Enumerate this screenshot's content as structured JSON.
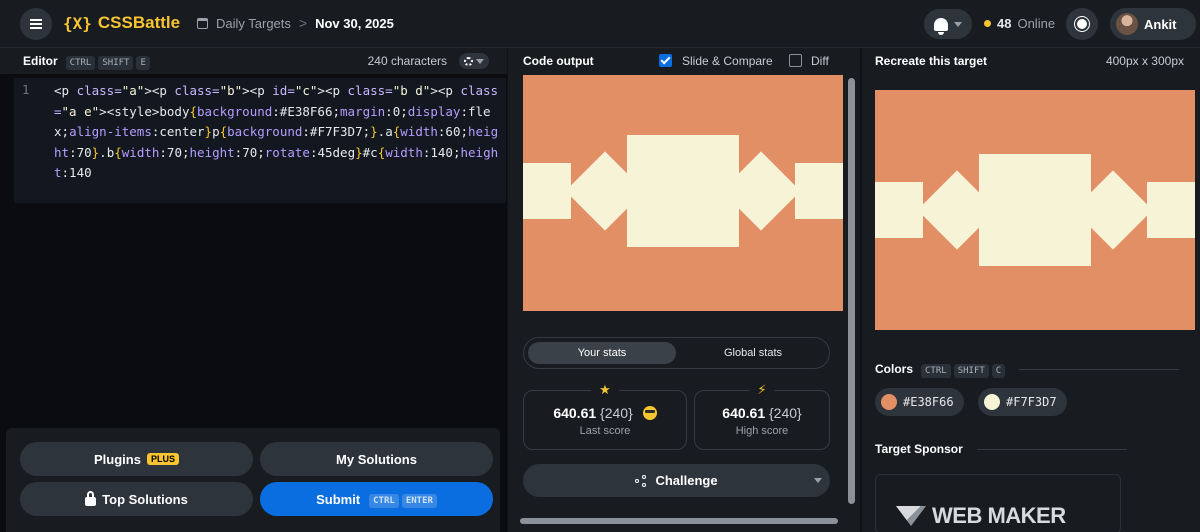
{
  "header": {
    "logo_mark": "{X}",
    "logo_text": "CSSBattle",
    "breadcrumb_section": "Daily Targets",
    "breadcrumb_separator": ">",
    "breadcrumb_date": "Nov 30, 2025",
    "online_count": "48",
    "online_label": "Online",
    "user_name": "Ankit"
  },
  "editor": {
    "title": "Editor",
    "shortcut": [
      "CTRL",
      "SHIFT",
      "E"
    ],
    "char_count": "240 characters",
    "line_number": "1",
    "code": "<p class=\"a\"><p class=\"b\"><p id=\"c\"><p class=\"b d\"><p class=\"a e\"><style>body{background:#E38F66;margin:0;display:flex;align-items:center}p{background:#F7F3D7;}.a{width:60;height:70}.b{width:70;height:70;rotate:45deg}#c{width:140;height:140"
  },
  "actions": {
    "plugins_label": "Plugins",
    "plugins_badge": "PLUS",
    "my_solutions_label": "My Solutions",
    "top_solutions_label": "Top Solutions",
    "submit_label": "Submit",
    "submit_shortcut": [
      "CTRL",
      "ENTER"
    ]
  },
  "output": {
    "title": "Code output",
    "slide_compare_label": "Slide & Compare",
    "slide_compare_checked": true,
    "diff_label": "Diff",
    "diff_checked": false,
    "tabs": [
      "Your stats",
      "Global stats"
    ],
    "active_tab": "Your stats",
    "last_score": {
      "score": "640.61",
      "chars": "{240}",
      "label": "Last score",
      "icon": "star-icon"
    },
    "high_score": {
      "score": "640.61",
      "chars": "{240}",
      "label": "High score",
      "icon": "lightning-icon"
    },
    "challenge_label": "Challenge"
  },
  "target": {
    "title": "Recreate this target",
    "dimensions": "400px x 300px",
    "colors_label": "Colors",
    "colors_shortcut": [
      "CTRL",
      "SHIFT",
      "C"
    ],
    "colors": [
      {
        "hex": "#E38F66"
      },
      {
        "hex": "#F7F3D7"
      }
    ],
    "sponsor_label": "Target Sponsor",
    "sponsor_name": "WEB MAKER"
  },
  "theme": {
    "background": "#E38F66",
    "foreground": "#F7F3D7",
    "accent": "#F7C531",
    "submit_blue": "#0B6EE0"
  }
}
